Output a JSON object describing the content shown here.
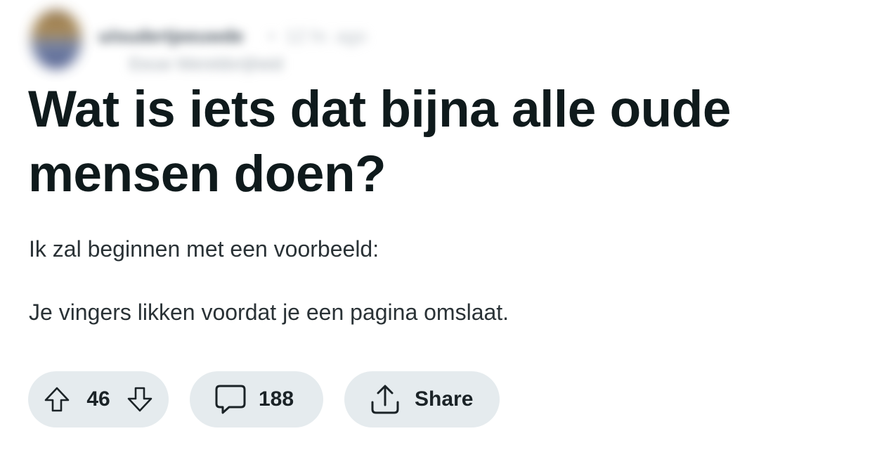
{
  "post": {
    "author": "u/oudertjeeuwde",
    "separator": "•",
    "time_ago": "12 hr. ago",
    "flair": "Eeuw Wereldvrijheid",
    "title": "Wat is iets dat bijna alle oude mensen doen?",
    "body": [
      "Ik zal beginnen met een voorbeeld:",
      "Je vingers likken voordat je een pagina omslaat."
    ]
  },
  "actions": {
    "upvote_icon": "arrow-up-outline-icon",
    "downvote_icon": "arrow-down-outline-icon",
    "vote_count": "46",
    "comment_icon": "speech-bubble-icon",
    "comment_count": "188",
    "share_icon": "share-upload-icon",
    "share_label": "Share"
  },
  "colors": {
    "pill_background": "#e5ebee",
    "text_primary": "#0f1a1c",
    "text_body": "#2a3236"
  }
}
